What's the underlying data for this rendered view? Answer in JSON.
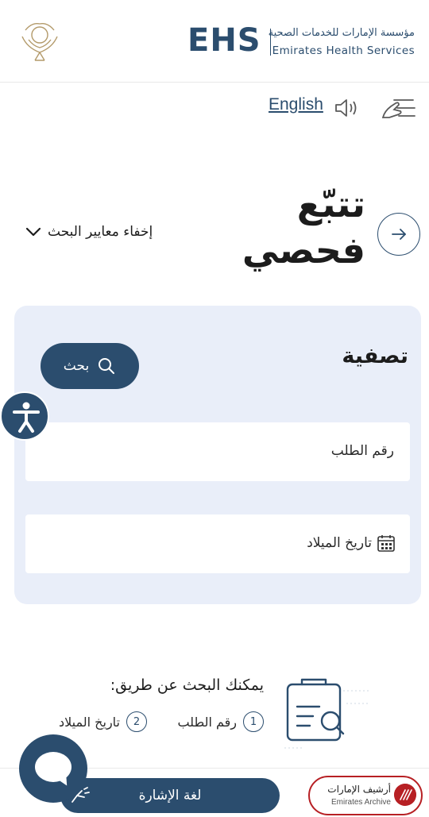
{
  "header": {
    "emblem_caption": "",
    "logo_letters": "EHS",
    "org_name_ar": "مؤسسة الإمارات للخدمات الصحية",
    "org_name_en": "Emirates Health Services"
  },
  "toolbar": {
    "language_link": "English",
    "speaker_icon": "speaker-icon",
    "menu_icon": "hand-menu-icon"
  },
  "page": {
    "title_line1": "تتبّع",
    "title_line2": "فحصي",
    "hide_filters_label": "إخفاء معايير البحث",
    "back_icon": "arrow-right-icon"
  },
  "filter": {
    "title": "تصفية",
    "search_label": "بحث",
    "field_request_number": "رقم الطلب",
    "field_birth_date": "تاريخ الميلاد"
  },
  "hint": {
    "title": "يمكنك البحث عن طريق:",
    "options": [
      {
        "num": "1",
        "label": "رقم الطلب"
      },
      {
        "num": "2",
        "label": "تاريخ الميلاد"
      }
    ]
  },
  "bottom": {
    "sign_language_label": "لغة الإشارة",
    "archive_ar": "أرشيف الإمارات",
    "archive_en": "Emirates Archive"
  },
  "colors": {
    "primary": "#2b4d6e",
    "panel_bg": "#e9eef9",
    "archive_red": "#b72024"
  }
}
